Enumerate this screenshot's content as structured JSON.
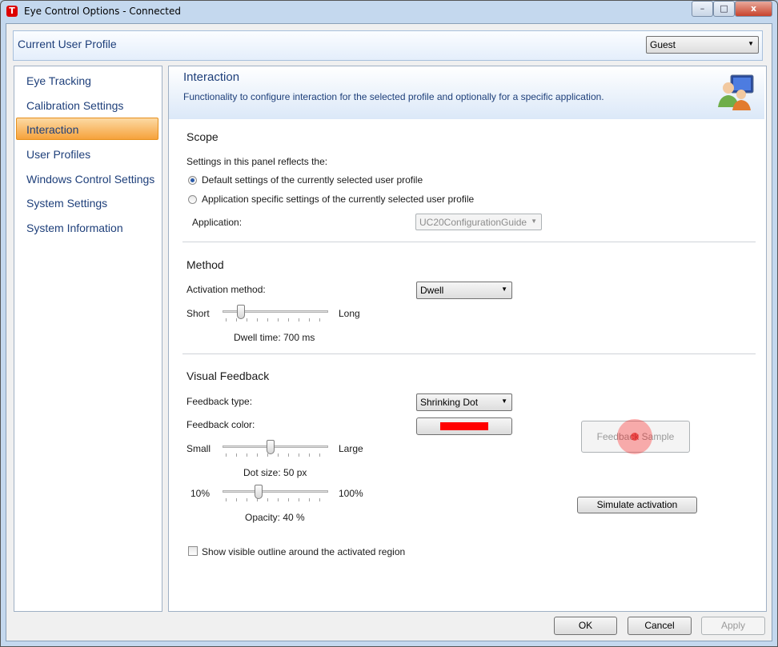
{
  "window": {
    "title": "Eye Control Options - Connected",
    "app_icon_letter": "T",
    "caption_buttons": {
      "minimize": "–",
      "maximize": "□",
      "close": "x"
    }
  },
  "profile": {
    "label": "Current User Profile",
    "selected": "Guest"
  },
  "sidebar": {
    "items": [
      {
        "label": "Eye Tracking"
      },
      {
        "label": "Calibration Settings"
      },
      {
        "label": "Interaction"
      },
      {
        "label": "User Profiles"
      },
      {
        "label": "Windows Control Settings"
      },
      {
        "label": "System Settings"
      },
      {
        "label": "System Information"
      }
    ],
    "selected_index": 2
  },
  "header": {
    "title": "Interaction",
    "description": "Functionality to configure interaction for the selected profile and optionally for a specific application.",
    "icon": "users-monitor-icon"
  },
  "scope": {
    "title": "Scope",
    "intro": "Settings in this panel reflects the:",
    "options": [
      {
        "label": "Default settings of the currently selected user profile",
        "checked": true
      },
      {
        "label": "Application specific settings of the currently selected user profile",
        "checked": false
      }
    ],
    "application_label": "Application:",
    "application_value": "UC20ConfigurationGuide"
  },
  "method": {
    "title": "Method",
    "activation_label": "Activation method:",
    "activation_value": "Dwell",
    "slider_min_label": "Short",
    "slider_max_label": "Long",
    "dwell_fraction": 0.15,
    "dwell_text": "Dwell time: 700 ms"
  },
  "visual": {
    "title": "Visual Feedback",
    "type_label": "Feedback type:",
    "type_value": "Shrinking Dot",
    "color_label": "Feedback color:",
    "color": "#ff0000",
    "size_min_label": "Small",
    "size_max_label": "Large",
    "size_fraction": 0.45,
    "size_text": "Dot size: 50 px",
    "opacity_min_label": "10%",
    "opacity_max_label": "100%",
    "opacity_fraction": 0.33,
    "opacity_text": "Opacity: 40 %",
    "sample_label": "Feedback Sample",
    "simulate_label": "Simulate activation",
    "outline_label": "Show visible outline around the activated region",
    "outline_checked": false
  },
  "footer": {
    "ok": "OK",
    "cancel": "Cancel",
    "apply": "Apply"
  },
  "colors": {
    "accent_selected": "#f6a23c",
    "header_text": "#1e3f7a"
  }
}
